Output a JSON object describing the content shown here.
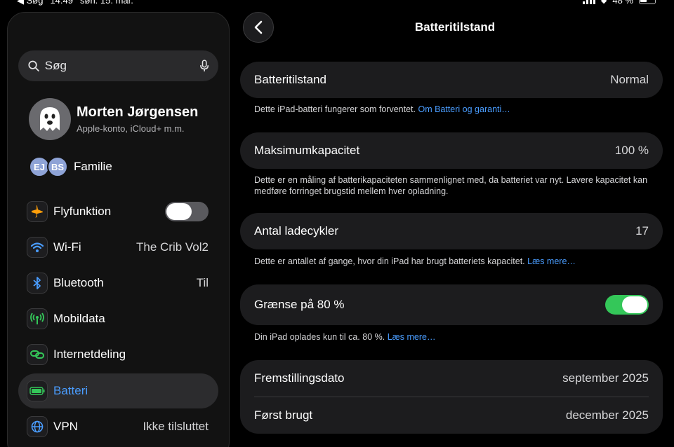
{
  "status_bar": {
    "back_label": "◀ Søg",
    "time": "14.49",
    "date": "søn. 15. mar.",
    "battery_pct": "48 %"
  },
  "sidebar": {
    "search_placeholder": "Søg",
    "profile": {
      "name": "Morten Jørgensen",
      "subtitle": "Apple-konto, iCloud+ m.m."
    },
    "family": {
      "avatars": [
        "EJ",
        "BS"
      ],
      "label": "Familie"
    },
    "items": [
      {
        "label": "Flyfunktion",
        "icon": "airplane-icon",
        "toggle": false
      },
      {
        "label": "Wi-Fi",
        "icon": "wifi-icon",
        "value": "The Crib Vol2"
      },
      {
        "label": "Bluetooth",
        "icon": "bluetooth-icon",
        "value": "Til"
      },
      {
        "label": "Mobildata",
        "icon": "antenna-icon"
      },
      {
        "label": "Internetdeling",
        "icon": "link-icon"
      },
      {
        "label": "Batteri",
        "icon": "battery-icon",
        "active": true
      },
      {
        "label": "VPN",
        "icon": "globe-icon",
        "value": "Ikke tilsluttet"
      }
    ]
  },
  "main": {
    "title": "Batteritilstand",
    "health": {
      "label": "Batteritilstand",
      "value": "Normal",
      "footer": "Dette iPad-batteri fungerer som forventet.",
      "footer_link": "Om Batteri og garanti…"
    },
    "capacity": {
      "label": "Maksimumkapacitet",
      "value": "100 %",
      "footer": "Dette er en måling af batterikapaciteten sammenlignet med, da batteriet var nyt. Lavere kapacitet kan medføre forringet brugstid mellem hver opladning."
    },
    "cycles": {
      "label": "Antal ladecykler",
      "value": "17",
      "footer": "Dette er antallet af gange, hvor din iPad har brugt batteriets kapacitet.",
      "footer_link": "Læs mere…"
    },
    "limit": {
      "label": "Grænse på 80 %",
      "toggle": true,
      "footer": "Din iPad oplades kun til ca. 80 %.",
      "footer_link": "Læs mere…"
    },
    "manufacture": {
      "label": "Fremstillingsdato",
      "value": "september 2025"
    },
    "first_use": {
      "label": "Først brugt",
      "value": "december 2025"
    }
  },
  "colors": {
    "accent": "#4a9dff",
    "toggle_on": "#34c759",
    "card": "#1c1c1e"
  }
}
